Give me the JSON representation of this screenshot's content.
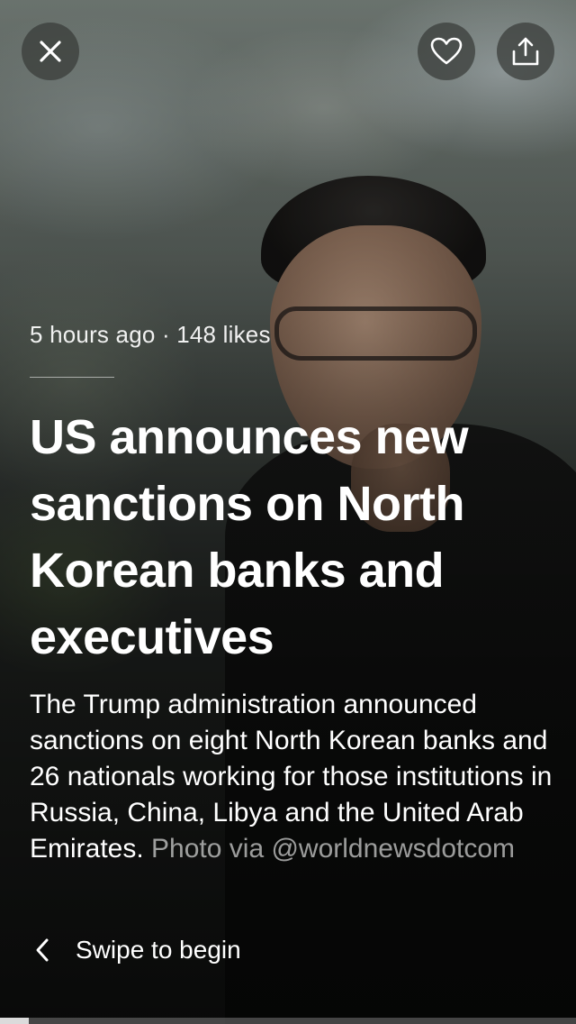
{
  "story": {
    "meta": "5 hours ago · 148 likes",
    "headline": "US announces new sanctions on North Korean banks and executives",
    "summary": "The Trump administration announced sanctions on eight North Korean banks and 26 nationals working for those institutions in Russia, China, Libya and the United Arab Emirates.",
    "credit": "Photo via @worldnewsdotcom"
  },
  "controls": {
    "close_icon": "close-icon",
    "like_icon": "heart-icon",
    "share_icon": "share-icon",
    "swipe_icon": "chevron-left-icon",
    "swipe_label": "Swipe to begin"
  },
  "progress": {
    "fraction": 0.05
  },
  "colors": {
    "text": "#ffffff",
    "button_bg": "#373a38",
    "progress_fill": "#ebebeb"
  }
}
